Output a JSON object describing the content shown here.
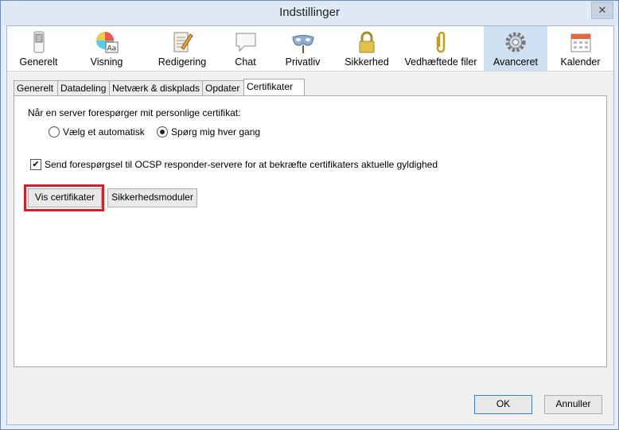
{
  "window": {
    "title": "Indstillinger",
    "close_glyph": "✕"
  },
  "toolbar": {
    "panes": [
      {
        "label": "Generelt",
        "icon": "switch-icon"
      },
      {
        "label": "Visning",
        "icon": "color-wheel-icon"
      },
      {
        "label": "Redigering",
        "icon": "notepad-pencil-icon"
      },
      {
        "label": "Chat",
        "icon": "speech-bubble-icon"
      },
      {
        "label": "Privatliv",
        "icon": "mask-icon"
      },
      {
        "label": "Sikkerhed",
        "icon": "padlock-icon"
      },
      {
        "label": "Vedhæftede filer",
        "icon": "paperclip-icon"
      },
      {
        "label": "Avanceret",
        "icon": "gear-icon",
        "active": true
      },
      {
        "label": "Kalender",
        "icon": "calendar-icon"
      }
    ]
  },
  "tabs": [
    {
      "label": "Generelt"
    },
    {
      "label": "Datadeling"
    },
    {
      "label": "Netværk & diskplads"
    },
    {
      "label": "Opdater"
    },
    {
      "label": "Certifikater",
      "active": true
    }
  ],
  "certificates": {
    "question": "Når en server forespørger mit personlige certifikat:",
    "options": [
      {
        "label": "Vælg et automatisk",
        "selected": false
      },
      {
        "label": "Spørg mig hver gang",
        "selected": true
      }
    ],
    "ocsp_label": "Send forespørgsel til OCSP responder-servere for at bekræfte certifikaters aktuelle gyldighed",
    "ocsp_checked": true,
    "view_certs_button": "Vis certifikater",
    "security_modules_button": "Sikkerhedsmoduler"
  },
  "footer": {
    "ok_label": "OK",
    "cancel_label": "Annuller"
  },
  "colors": {
    "highlight": "#d91f26",
    "active_pane": "#cfe0f3"
  }
}
